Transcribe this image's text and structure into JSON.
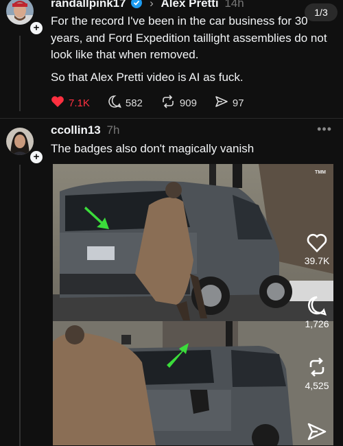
{
  "post1": {
    "username": "randallpink17",
    "verified_icon": "verified-badge-icon",
    "reply_target": "Alex Pretti",
    "time": "14h",
    "text1": "For the record I've been in the car business for 30 years, and Ford Expedition taillight assemblies do not look like that when removed.",
    "text2": "So that Alex Pretti video is AI as fuck.",
    "actions": {
      "likes": "7.1K",
      "replies": "582",
      "reposts": "909",
      "shares": "97"
    },
    "like_color": "#ff3040"
  },
  "counter": "1/3",
  "post2": {
    "username": "ccollin13",
    "time": "7h",
    "text": "The badges also don't magically vanish",
    "media": {
      "watermark": "TMM",
      "side_stats": {
        "likes": "39.7K",
        "comments": "1,726",
        "reposts": "4,525"
      },
      "arrow_color": "#3bdc3b"
    }
  }
}
